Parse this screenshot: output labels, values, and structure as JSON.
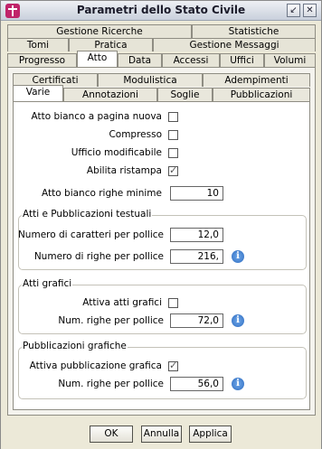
{
  "window": {
    "title": "Parametri dello Stato Civile",
    "min_icon": "↙",
    "close_icon": "✕"
  },
  "tabs_row1": [
    "Gestione Ricerche",
    "Statistiche"
  ],
  "tabs_row2": [
    "Tomi",
    "Pratica",
    "Gestione Messaggi"
  ],
  "tabs_row3": [
    "Progresso",
    "Atto",
    "Data",
    "Accessi",
    "Uffici",
    "Volumi"
  ],
  "inner_tabs_row1": [
    "Certificati",
    "Modulistica",
    "Adempimenti"
  ],
  "inner_tabs_row2": [
    "Varie",
    "Annotazioni",
    "Soglie",
    "Pubblicazioni"
  ],
  "general": {
    "atto_bianco_label": "Atto bianco a pagina nuova",
    "compresso_label": "Compresso",
    "ufficio_label": "Ufficio modificabile",
    "ristampa_label": "Abilita ristampa",
    "righe_minime_label": "Atto bianco righe minime",
    "righe_minime_value": "10"
  },
  "atti_testuali": {
    "title": "Atti e Pubblicazioni testuali",
    "caratteri_label": "Numero di caratteri per pollice",
    "caratteri_value": "12,0",
    "righe_label": "Numero di righe per pollice",
    "righe_value": "216,"
  },
  "atti_grafici": {
    "title": "Atti grafici",
    "attiva_label": "Attiva atti grafici",
    "righe_label": "Num. righe per pollice",
    "righe_value": "72,0"
  },
  "pubblicazioni_grafiche": {
    "title": "Pubblicazioni grafiche",
    "attiva_label": "Attiva pubblicazione grafica",
    "righe_label": "Num. righe per pollice",
    "righe_value": "56,0"
  },
  "buttons": {
    "ok": "OK",
    "annulla": "Annulla",
    "applica": "Applica"
  },
  "info_glyph": "i"
}
